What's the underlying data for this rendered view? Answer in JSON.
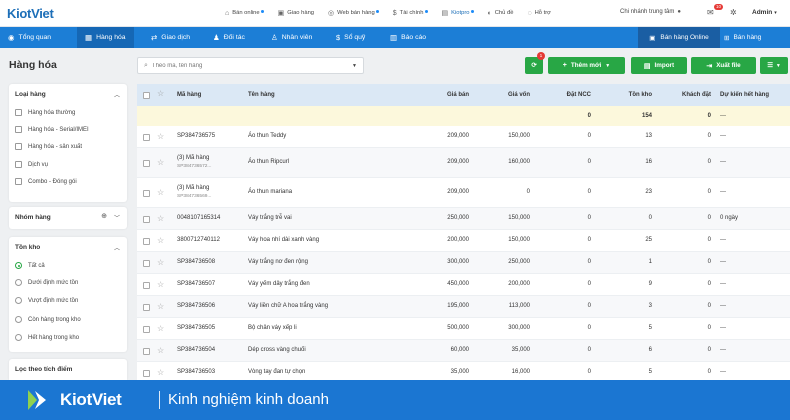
{
  "app": {
    "logo": "KiotViet"
  },
  "topbar": {
    "links": [
      {
        "label": "Bán online",
        "icon": "store-icon",
        "dot": true
      },
      {
        "label": "Giao hàng",
        "icon": "truck-icon",
        "dot": false
      },
      {
        "label": "Web bán hàng",
        "icon": "globe-icon",
        "dot": true
      },
      {
        "label": "Tài chính",
        "icon": "coin-icon",
        "dot": true
      },
      {
        "label": "Kiotpro",
        "icon": "kiotpro-icon",
        "dot": true
      },
      {
        "label": "Chủ đề",
        "icon": "palette-icon",
        "dot": false
      },
      {
        "label": "Hỗ trợ",
        "icon": "chat-icon",
        "dot": false
      }
    ],
    "branch": "Chi nhánh trung tâm",
    "mail_badge": "10",
    "user": "Admin"
  },
  "nav": {
    "items": [
      {
        "label": "Tổng quan",
        "icon": "eye-icon"
      },
      {
        "label": "Hàng hóa",
        "icon": "box-icon",
        "active": true
      },
      {
        "label": "Giao dịch",
        "icon": "exchange-icon"
      },
      {
        "label": "Đối tác",
        "icon": "partner-icon"
      },
      {
        "label": "Nhân viên",
        "icon": "staff-icon"
      },
      {
        "label": "Sổ quỹ",
        "icon": "cash-icon"
      },
      {
        "label": "Báo cáo",
        "icon": "chart-icon"
      }
    ],
    "online_label": "Bán hàng Online",
    "sale_label": "Bán hàng"
  },
  "page": {
    "title": "Hàng hóa"
  },
  "search": {
    "placeholder": "Theo mã, tên hàng"
  },
  "actions": {
    "sync_badge": "1",
    "new_label": "Thêm mới",
    "import_label": "Import",
    "export_label": "Xuất file"
  },
  "sidebar": {
    "product_type": {
      "title": "Loại hàng",
      "options": [
        "Hàng hóa thường",
        "Hàng hóa - Serial/IMEI",
        "Hàng hóa - sản xuất",
        "Dịch vụ",
        "Combo - Đóng gói"
      ]
    },
    "group": {
      "title": "Nhóm hàng"
    },
    "stock": {
      "title": "Tồn kho",
      "options": [
        "Tất cả",
        "Dưới định mức tồn",
        "Vượt định mức tồn",
        "Còn hàng trong kho",
        "Hết hàng trong kho"
      ],
      "selected": 0
    },
    "points": {
      "title": "Lọc theo tích điểm"
    }
  },
  "table": {
    "headers": {
      "code": "Mã hàng",
      "name": "Tên hàng",
      "price": "Giá bán",
      "cost": "Giá vốn",
      "ordered_ncc": "Đặt NCC",
      "stock": "Tồn kho",
      "customer_order": "Khách đặt",
      "expected_out": "Dự kiến hết hàng"
    },
    "summary": {
      "ordered_ncc": "0",
      "stock": "154",
      "customer_order": "0",
      "expected_out": "---"
    },
    "rows": [
      {
        "code": "SP384736575",
        "sub": "",
        "name": "Áo thun Teddy",
        "price": "209,000",
        "cost": "150,000",
        "ncc": "0",
        "stock": "13",
        "cust": "0",
        "exp": "---"
      },
      {
        "code": "(3) Mã hàng",
        "sub": "SP384736572...",
        "name": "Áo thun Ripcurl",
        "price": "209,000",
        "cost": "160,000",
        "ncc": "0",
        "stock": "16",
        "cust": "0",
        "exp": "---"
      },
      {
        "code": "(3) Mã hàng",
        "sub": "SP384736569...",
        "name": "Áo thun mariana",
        "price": "209,000",
        "cost": "0",
        "ncc": "0",
        "stock": "23",
        "cust": "0",
        "exp": "---"
      },
      {
        "code": "0048107165314",
        "sub": "",
        "name": "Váy trắng trễ vai",
        "price": "250,000",
        "cost": "150,000",
        "ncc": "0",
        "stock": "0",
        "cust": "0",
        "exp": "0 ngày"
      },
      {
        "code": "3800712740112",
        "sub": "",
        "name": "Váy hoa nhí dài xanh vàng",
        "price": "200,000",
        "cost": "150,000",
        "ncc": "0",
        "stock": "25",
        "cust": "0",
        "exp": "---"
      },
      {
        "code": "SP384736508",
        "sub": "",
        "name": "Váy trắng nơ đen rộng",
        "price": "300,000",
        "cost": "250,000",
        "ncc": "0",
        "stock": "1",
        "cust": "0",
        "exp": "---"
      },
      {
        "code": "SP384736507",
        "sub": "",
        "name": "Váy yếm dây trắng đen",
        "price": "450,000",
        "cost": "200,000",
        "ncc": "0",
        "stock": "9",
        "cust": "0",
        "exp": "---"
      },
      {
        "code": "SP384736506",
        "sub": "",
        "name": "Váy liền chữ A hoa trắng vàng",
        "price": "195,000",
        "cost": "113,000",
        "ncc": "0",
        "stock": "3",
        "cust": "0",
        "exp": "---"
      },
      {
        "code": "SP384736505",
        "sub": "",
        "name": "Bộ chân váy xếp li",
        "price": "500,000",
        "cost": "300,000",
        "ncc": "0",
        "stock": "5",
        "cust": "0",
        "exp": "---"
      },
      {
        "code": "SP384736504",
        "sub": "",
        "name": "Dép cross vàng chuối",
        "price": "60,000",
        "cost": "35,000",
        "ncc": "0",
        "stock": "6",
        "cust": "0",
        "exp": "---"
      },
      {
        "code": "SP384736503",
        "sub": "",
        "name": "Vòng tay đan tự chọn",
        "price": "35,000",
        "cost": "16,000",
        "ncc": "0",
        "stock": "5",
        "cust": "0",
        "exp": "---"
      }
    ]
  },
  "footer": {
    "brand": "KiotViet",
    "tagline": "Kinh nghiệm kinh doanh"
  },
  "colors": {
    "primary": "#1c7ed6",
    "green": "#28a745",
    "header_row": "#dbe8f5",
    "summary_row": "#fcf8dc",
    "badge": "#e53935"
  }
}
